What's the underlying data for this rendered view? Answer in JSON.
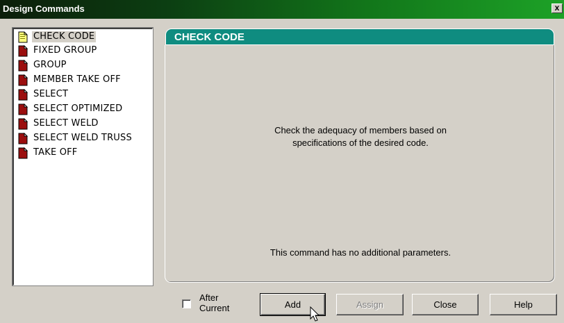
{
  "window": {
    "title": "Design Commands",
    "close_glyph": "x"
  },
  "commands": {
    "items": [
      {
        "label": "CHECK CODE",
        "selected": true
      },
      {
        "label": "FIXED GROUP",
        "selected": false
      },
      {
        "label": "GROUP",
        "selected": false
      },
      {
        "label": "MEMBER TAKE OFF",
        "selected": false
      },
      {
        "label": "SELECT",
        "selected": false
      },
      {
        "label": "SELECT OPTIMIZED",
        "selected": false
      },
      {
        "label": "SELECT WELD",
        "selected": false
      },
      {
        "label": "SELECT WELD TRUSS",
        "selected": false
      },
      {
        "label": "TAKE OFF",
        "selected": false
      }
    ]
  },
  "panel": {
    "title": "CHECK CODE",
    "description_line1": "Check the adequacy of members based on",
    "description_line2": "specifications of the desired code.",
    "no_params": "This command has no additional parameters."
  },
  "options": {
    "after_current_line1": "After",
    "after_current_line2": "Current",
    "after_current_checked": false
  },
  "buttons": {
    "add": "Add",
    "assign": "Assign",
    "close": "Close",
    "help": "Help"
  },
  "colors": {
    "title_gradient_start": "#0c1e0a",
    "title_gradient_end": "#1da227",
    "panel_header": "#0f8c80",
    "selected_icon": "#ffff80",
    "doc_icon": "#9b0f0f"
  }
}
